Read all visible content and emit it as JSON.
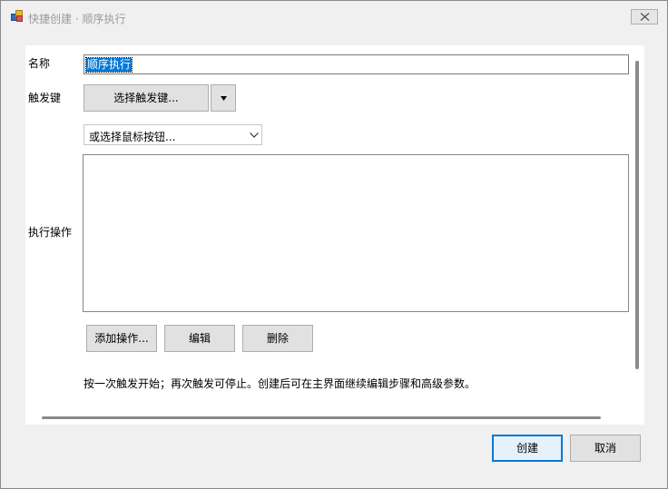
{
  "window": {
    "title": "快捷创建 · 顺序执行"
  },
  "form": {
    "name_label": "名称",
    "name_value": "顺序执行",
    "trigger_label": "触发键",
    "select_trigger_label": "选择触发键...",
    "mouse_button_placeholder": "或选择鼠标按钮...",
    "actions_label": "执行操作",
    "actions_list": [],
    "add_action_label": "添加操作...",
    "edit_label": "编辑",
    "delete_label": "删除",
    "hint": "按一次触发开始；再次触发可停止。创建后可在主界面继续编辑步骤和高级参数。"
  },
  "footer": {
    "create_label": "创建",
    "cancel_label": "取消"
  },
  "colors": {
    "accent": "#0078d7",
    "selection": "#0078d7"
  }
}
